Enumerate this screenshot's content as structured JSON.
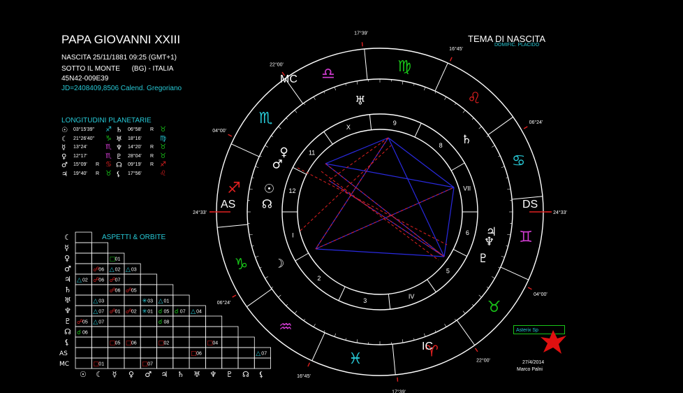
{
  "header": {
    "title": "PAPA GIOVANNI XXIII",
    "birth": "NASCITA 25/11/1881 09:25 (GMT+1)",
    "place": "SOTTO IL MONTE      (BG) - ITALIA",
    "coords": "45N42-009E39",
    "jd": "JD=2408409,8506  Calend. Gregoriano"
  },
  "chart_header": {
    "title": "TEMA DI NASCITA",
    "house_system": "DOMIFIC. PLACIDO"
  },
  "planets_panel": {
    "title": "LONGITUDINI PLANETARIE",
    "left": [
      {
        "glyph": "☉",
        "deg": "03°15'39\"",
        "retro": "",
        "sign": "♐"
      },
      {
        "glyph": "☾",
        "deg": "21°26'40\"",
        "retro": "",
        "sign": "♑"
      },
      {
        "glyph": "☿",
        "deg": "13°24'",
        "retro": "",
        "sign": "♏"
      },
      {
        "glyph": "♀",
        "deg": "12°17'",
        "retro": "",
        "sign": "♏"
      },
      {
        "glyph": "♂",
        "deg": "15°09'",
        "retro": "R",
        "sign": "♋"
      },
      {
        "glyph": "♃",
        "deg": "19°40'",
        "retro": "R",
        "sign": "♉"
      }
    ],
    "right": [
      {
        "glyph": "♄",
        "deg": "06°58'",
        "retro": "R",
        "sign": "♉"
      },
      {
        "glyph": "♅",
        "deg": "18°16'",
        "retro": "",
        "sign": "♍"
      },
      {
        "glyph": "♆",
        "deg": "14°20'",
        "retro": "R",
        "sign": "♉"
      },
      {
        "glyph": "♇",
        "deg": "28°04'",
        "retro": "R",
        "sign": "♉"
      },
      {
        "glyph": "☊",
        "deg": "09°19'",
        "retro": "R",
        "sign": "♐"
      },
      {
        "glyph": "⚸",
        "deg": "17°56'",
        "retro": "",
        "sign": "♌"
      }
    ]
  },
  "aspects": {
    "title": "ASPETTI  &  ORBITE",
    "row_labels": [
      "☾",
      "☿",
      "♀",
      "♂",
      "♃",
      "♄",
      "♅",
      "♆",
      "♇",
      "☊",
      "⚸",
      "AS",
      "MC"
    ],
    "col_labels": [
      "☉",
      "☾",
      "☿",
      "♀",
      "♂",
      "♃",
      "♄",
      "♅",
      "♆",
      "♇",
      "☊",
      "⚸"
    ],
    "cells": [
      {
        "r": 2,
        "c": 2,
        "s": "□",
        "v": "01",
        "col": "#18c418"
      },
      {
        "r": 3,
        "c": 1,
        "s": "☍",
        "v": "06",
        "col": "#e02020"
      },
      {
        "r": 3,
        "c": 2,
        "s": "△",
        "v": "02",
        "col": "#27c9d6"
      },
      {
        "r": 3,
        "c": 3,
        "s": "△",
        "v": "03",
        "col": "#27c9d6"
      },
      {
        "r": 4,
        "c": 0,
        "s": "△",
        "v": "02",
        "col": "#27c9d6"
      },
      {
        "r": 4,
        "c": 1,
        "s": "☍",
        "v": "06",
        "col": "#e02020"
      },
      {
        "r": 4,
        "c": 2,
        "s": "☍",
        "v": "07",
        "col": "#e02020"
      },
      {
        "r": 5,
        "c": 2,
        "s": "☍",
        "v": "06",
        "col": "#e02020"
      },
      {
        "r": 5,
        "c": 3,
        "s": "☍",
        "v": "05",
        "col": "#e02020"
      },
      {
        "r": 6,
        "c": 1,
        "s": "△",
        "v": "03",
        "col": "#27c9d6"
      },
      {
        "r": 6,
        "c": 4,
        "s": "✳",
        "v": "03",
        "col": "#27c9d6"
      },
      {
        "r": 6,
        "c": 5,
        "s": "△",
        "v": "01",
        "col": "#27c9d6"
      },
      {
        "r": 7,
        "c": 1,
        "s": "△",
        "v": "07",
        "col": "#27c9d6"
      },
      {
        "r": 7,
        "c": 2,
        "s": "☍",
        "v": "01",
        "col": "#e02020"
      },
      {
        "r": 7,
        "c": 3,
        "s": "☍",
        "v": "02",
        "col": "#e02020"
      },
      {
        "r": 7,
        "c": 4,
        "s": "✳",
        "v": "01",
        "col": "#27c9d6"
      },
      {
        "r": 7,
        "c": 5,
        "s": "☌",
        "v": "05",
        "col": "#18c418"
      },
      {
        "r": 7,
        "c": 6,
        "s": "☌",
        "v": "07",
        "col": "#18c418"
      },
      {
        "r": 7,
        "c": 7,
        "s": "△",
        "v": "04",
        "col": "#27c9d6"
      },
      {
        "r": 8,
        "c": 0,
        "s": "☍",
        "v": "05",
        "col": "#e02020"
      },
      {
        "r": 8,
        "c": 1,
        "s": "△",
        "v": "07",
        "col": "#27c9d6"
      },
      {
        "r": 8,
        "c": 5,
        "s": "☌",
        "v": "08",
        "col": "#18c418"
      },
      {
        "r": 9,
        "c": 0,
        "s": "☌",
        "v": "06",
        "col": "#18c418"
      },
      {
        "r": 10,
        "c": 2,
        "s": "□",
        "v": "05",
        "col": "#e02020"
      },
      {
        "r": 10,
        "c": 3,
        "s": "□",
        "v": "06",
        "col": "#e02020"
      },
      {
        "r": 10,
        "c": 5,
        "s": "□",
        "v": "02",
        "col": "#e02020"
      },
      {
        "r": 10,
        "c": 8,
        "s": "□",
        "v": "04",
        "col": "#e02020"
      },
      {
        "r": 11,
        "c": 7,
        "s": "□",
        "v": "06",
        "col": "#e02020"
      },
      {
        "r": 11,
        "c": 11,
        "s": "△",
        "v": "07",
        "col": "#27c9d6"
      },
      {
        "r": 12,
        "c": 1,
        "s": "□",
        "v": "01",
        "col": "#e02020"
      },
      {
        "r": 12,
        "c": 4,
        "s": "□",
        "v": "07",
        "col": "#e02020"
      }
    ]
  },
  "wheel": {
    "angles": {
      "mc": "MC",
      "as": "AS",
      "ds": "DS",
      "ic": "IC"
    },
    "cusp_degrees": [
      "17°39'",
      "22°00'",
      "04°00'",
      "24°33'",
      "06°24'",
      "16°45'",
      "17°39'",
      "22°00'",
      "04°00'",
      "24°33'",
      "06°24'",
      "16°45'"
    ],
    "house_numbers": [
      "I",
      "2",
      "3",
      "IV",
      "5",
      "6",
      "VII",
      "8",
      "9",
      "X",
      "11",
      "12"
    ]
  },
  "footer": {
    "software": "Asterix Sp",
    "date": "27/4/2014",
    "author": "Marco Palni"
  },
  "colors": {
    "cyan": "#27c9d6",
    "red": "#e02020",
    "green": "#18c418",
    "blue": "#2a2ae0",
    "magenta": "#d23cd2"
  }
}
